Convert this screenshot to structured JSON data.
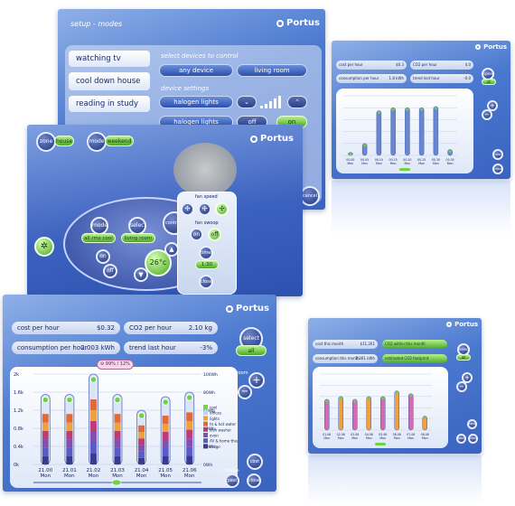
{
  "brand": "Portus",
  "setup_modes": {
    "title": "setup - modes",
    "modes": [
      "watching tv",
      "cool down house",
      "reading in study"
    ],
    "select_devices_label": "select devices to control",
    "device_buttons": [
      "any device",
      "living room"
    ],
    "device_settings_label": "device settings",
    "settings_rows": [
      {
        "label": "halogen lights",
        "off": "",
        "on": ""
      },
      {
        "label": "halogen lights",
        "off": "off",
        "on": "on"
      }
    ],
    "cancel_label": "cancel"
  },
  "controls": {
    "zone_label": "zone",
    "zone_value": "house",
    "mode_label": "mode",
    "mode_value": "weekend",
    "inner_mode": "mode",
    "inner_select": "select",
    "inner_mode_value": "all rms cool",
    "inner_select_value": "living room",
    "on_label": "on",
    "off_label": "off",
    "temperature": "26°c",
    "controls_label": "controls",
    "fan_speed_label": "fan speed",
    "fan_swoop_label": "fan swoop",
    "timer_label": "timer",
    "timer_value": "1:30",
    "close_label": "close"
  },
  "energy_main": {
    "fields": [
      {
        "label": "cost per hour",
        "value": "$0.32"
      },
      {
        "label": "CO2 per hour",
        "value": "2.10 kg"
      },
      {
        "label": "consumption per hour",
        "value": "2.003 kWh"
      },
      {
        "label": "trend last hour",
        "value": "-3%"
      }
    ],
    "select_label": "select",
    "all_label": "all",
    "zoom_label": "zoom",
    "cost_label": "cost",
    "compare_label": "compare",
    "past_label": "past",
    "close_label": "close",
    "tooltip": "99% / 12%",
    "legend": [
      "cool",
      "offices",
      "lights",
      "ht & hot water",
      "dish washer",
      "oven",
      "AV & home theatre",
      "fridge"
    ]
  },
  "chart_data": {
    "type": "bar",
    "categories": [
      "21.00 Mon",
      "21.01 Mon",
      "21.02 Mon",
      "21.03 Mon",
      "21.04 Mon",
      "21.05 Mon",
      "21.06 Mon"
    ],
    "left_ticks": [
      "2k",
      "1.6k",
      "1.2k",
      "0.8k",
      "0.4k",
      "0k"
    ],
    "right_ticks": [
      "100Wh",
      "80Wh",
      "60Wh",
      "40Wh",
      "20Wh",
      "0Wh"
    ],
    "ylim": [
      0,
      2
    ],
    "values": [
      1.55,
      1.55,
      2.0,
      1.55,
      1.2,
      1.5,
      1.6
    ],
    "legend_colors": [
      "#7ad04a",
      "#b0d8f0",
      "#f0a040",
      "#e06a3a",
      "#c03a7a",
      "#8050b0",
      "#5a5ac8",
      "#3a3a90"
    ]
  },
  "mini_panels": {
    "top_right": {
      "fields": [
        {
          "label": "cost per hour",
          "value": "$0.3"
        },
        {
          "label": "CO2 per hour",
          "value": "4.0"
        },
        {
          "label": "consumption per hour",
          "value": "1.8 kWh"
        },
        {
          "label": "trend last hour",
          "value": "-0.0"
        }
      ],
      "categories": [
        "00.00 Mon",
        "00.05 Mon",
        "00.10 Mon",
        "00.15 Mon",
        "00.20 Mon",
        "00.25 Mon",
        "00.30 Mon",
        "00.35 Mon"
      ],
      "values": [
        0.05,
        0.2,
        0.75,
        0.8,
        0.8,
        0.8,
        0.82,
        0.1
      ],
      "speed_label": "speed",
      "all_label": "all",
      "buttons": [
        "cost",
        "close"
      ]
    },
    "bottom_right": {
      "fields": [
        {
          "label": "cost this month",
          "value": "$11,261"
        },
        {
          "label": "CO2 within this month",
          "value": ""
        },
        {
          "label": "consumption this month",
          "value": "2,361 kWh"
        },
        {
          "label": "estimated CO2 footprint",
          "value": ""
        }
      ],
      "categories": [
        "01.06 Mon",
        "02.06 Mon",
        "03.06 Mon",
        "04.06 Mon",
        "05.06 Mon",
        "06.06 Mon",
        "07.06 Mon",
        "08.06 Mon"
      ],
      "values": [
        0.55,
        0.6,
        0.55,
        0.6,
        0.6,
        0.7,
        0.65,
        0.25
      ],
      "select_label": "select",
      "all_label": "all",
      "buttons": [
        "cost",
        "past",
        "close"
      ]
    }
  }
}
